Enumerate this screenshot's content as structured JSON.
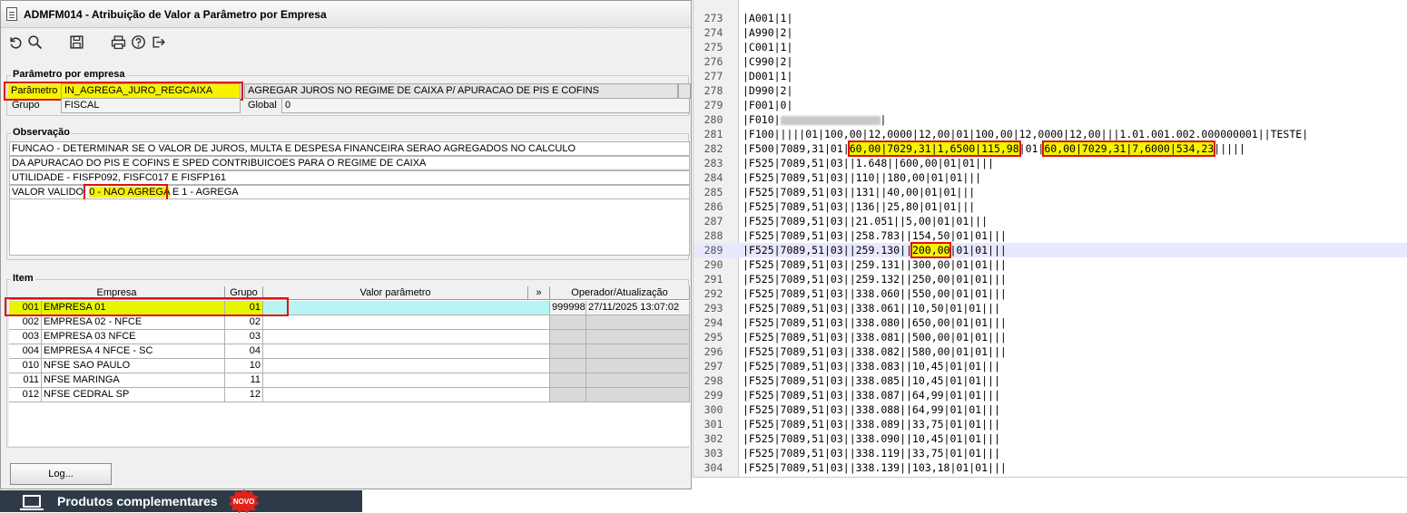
{
  "window": {
    "title": "ADMFM014 - Atribuição de Valor a Parâmetro por Empresa",
    "toolbar": [
      "undo-icon",
      "search-icon",
      "save-icon",
      "print-icon",
      "help-icon",
      "exit-icon"
    ]
  },
  "param_group": {
    "legend": "Parâmetro por empresa",
    "parametro_label": "Parâmetro",
    "parametro_value": "IN_AGREGA_JURO_REGCAIXA",
    "parametro_desc": "AGREGAR JUROS NO REGIME DE CAIXA P/ APURACAO DE PIS E COFINS",
    "grupo_label": "Grupo",
    "grupo_value": "FISCAL",
    "global_label": "Global",
    "global_value": "0"
  },
  "obs_group": {
    "legend": "Observação",
    "lines": [
      "FUNCAO - DETERMINAR SE O VALOR DE JUROS, MULTA E DESPESA FINANCEIRA SERAO AGREGADOS NO CALCULO",
      "DA APURACAO DO PIS E COFINS E SPED CONTRIBUICOES PARA O REGIME DE CAIXA",
      "UTILIDADE - FISFP092, FISFC017 E FISFP161"
    ],
    "valid_prefix": "VALOR VALIDO: ",
    "valid_highlight": "0 - NAO AGREGA",
    "valid_suffix": " E 1 - AGREGA"
  },
  "item_group": {
    "legend": "Item",
    "headers": {
      "empresa": "Empresa",
      "grupo": "Grupo",
      "valor": "Valor parâmetro",
      "more": "»",
      "operador": "Operador/Atualização"
    },
    "rows": [
      {
        "code": "001",
        "name": "EMPRESA 01",
        "grupo": "01",
        "valor": "",
        "operador": "999998",
        "data": "27/11/2025 13:07:02",
        "selected": true
      },
      {
        "code": "002",
        "name": "EMPRESA 02 - NFCE",
        "grupo": "02",
        "valor": "",
        "operador": "",
        "data": ""
      },
      {
        "code": "003",
        "name": "EMPRESA 03 NFCE",
        "grupo": "03",
        "valor": "",
        "operador": "",
        "data": ""
      },
      {
        "code": "004",
        "name": "EMPRESA 4 NFCE - SC",
        "grupo": "04",
        "valor": "",
        "operador": "",
        "data": ""
      },
      {
        "code": "010",
        "name": "NFSE SAO PAULO",
        "grupo": "10",
        "valor": "",
        "operador": "",
        "data": ""
      },
      {
        "code": "011",
        "name": "NFSE MARINGA",
        "grupo": "11",
        "valor": "",
        "operador": "",
        "data": ""
      },
      {
        "code": "012",
        "name": "NFSE CEDRAL SP",
        "grupo": "12",
        "valor": "",
        "operador": "",
        "data": ""
      }
    ]
  },
  "log_button": "Log...",
  "promo": {
    "text": "Produtos complementares",
    "badge": "NOVO"
  },
  "editor": {
    "lines": [
      {
        "n": "273",
        "t": "|A001|1|"
      },
      {
        "n": "274",
        "t": "|A990|2|"
      },
      {
        "n": "275",
        "t": "|C001|1|"
      },
      {
        "n": "276",
        "t": "|C990|2|"
      },
      {
        "n": "277",
        "t": "|D001|1|"
      },
      {
        "n": "278",
        "t": "|D990|2|"
      },
      {
        "n": "279",
        "t": "|F001|0|"
      },
      {
        "n": "280",
        "t": "|F010|",
        "t2": "|"
      },
      {
        "n": "281",
        "t": "|F100|||||01|100,00|12,0000|12,00|01|100,00|12,0000|12,00|||1.01.001.002.000000001||TESTE|"
      },
      {
        "n": "282",
        "t": "|F500|7089,31|01|",
        "m1": "60,00|7029,31|1,6500|115,98",
        "t2": "|01|",
        "m2": "60,00|7029,31|7,6000|534,23",
        "t3": "|||||"
      },
      {
        "n": "283",
        "t": "|F525|7089,51|03||1.648||600,00|01|01|||"
      },
      {
        "n": "284",
        "t": "|F525|7089,51|03||110||180,00|01|01|||"
      },
      {
        "n": "285",
        "t": "|F525|7089,51|03||131||40,00|01|01|||"
      },
      {
        "n": "286",
        "t": "|F525|7089,51|03||136||25,80|01|01|||"
      },
      {
        "n": "287",
        "t": "|F525|7089,51|03||21.051||5,00|01|01|||"
      },
      {
        "n": "288",
        "t": "|F525|7089,51|03||258.783||154,50|01|01|||"
      },
      {
        "n": "289",
        "t": "|F525|7089,51|03||259.130||",
        "m1": "200,00",
        "t2": "|01|01|||",
        "cur": true
      },
      {
        "n": "290",
        "t": "|F525|7089,51|03||259.131||300,00|01|01|||"
      },
      {
        "n": "291",
        "t": "|F525|7089,51|03||259.132||250,00|01|01|||"
      },
      {
        "n": "292",
        "t": "|F525|7089,51|03||338.060||550,00|01|01|||"
      },
      {
        "n": "293",
        "t": "|F525|7089,51|03||338.061||10,50|01|01|||"
      },
      {
        "n": "294",
        "t": "|F525|7089,51|03||338.080||650,00|01|01|||"
      },
      {
        "n": "295",
        "t": "|F525|7089,51|03||338.081||500,00|01|01|||"
      },
      {
        "n": "296",
        "t": "|F525|7089,51|03||338.082||580,00|01|01|||"
      },
      {
        "n": "297",
        "t": "|F525|7089,51|03||338.083||10,45|01|01|||"
      },
      {
        "n": "298",
        "t": "|F525|7089,51|03||338.085||10,45|01|01|||"
      },
      {
        "n": "299",
        "t": "|F525|7089,51|03||338.087||64,99|01|01|||"
      },
      {
        "n": "300",
        "t": "|F525|7089,51|03||338.088||64,99|01|01|||"
      },
      {
        "n": "301",
        "t": "|F525|7089,51|03||338.089||33,75|01|01|||"
      },
      {
        "n": "302",
        "t": "|F525|7089,51|03||338.090||10,45|01|01|||"
      },
      {
        "n": "303",
        "t": "|F525|7089,51|03||338.119||33,75|01|01|||"
      },
      {
        "n": "304",
        "t": "|F525|7089,51|03||338.139||103,18|01|01|||"
      }
    ]
  }
}
